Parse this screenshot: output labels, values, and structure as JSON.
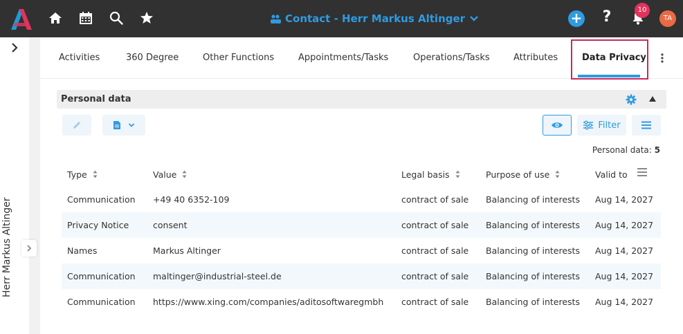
{
  "header": {
    "title": "Contact - Herr Markus Altinger",
    "notification_count": "10",
    "avatar_initials": "TA",
    "help_label": "?",
    "plus_label": "+",
    "accent_color": "#2f9be0",
    "icons": [
      "home-icon",
      "calendar-icon",
      "search-icon",
      "star-icon",
      "contact-icon",
      "chevron-down-icon",
      "plus-icon",
      "help-icon",
      "bell-icon"
    ]
  },
  "sidebar": {
    "record_name": "Herr Markus Altinger"
  },
  "tabs": [
    {
      "label": "Activities"
    },
    {
      "label": "360 Degree"
    },
    {
      "label": "Other Functions"
    },
    {
      "label": "Appointments/Tasks"
    },
    {
      "label": "Operations/Tasks"
    },
    {
      "label": "Attributes"
    },
    {
      "label": "Data Privacy",
      "active": true
    }
  ],
  "panel": {
    "title": "Personal data",
    "filter_label": "Filter",
    "count_label": "Personal data:",
    "count_value": "5"
  },
  "table": {
    "columns": [
      "Type",
      "Value",
      "Legal basis",
      "Purpose of use",
      "Valid to"
    ],
    "rows": [
      [
        "Communication",
        "+49 40 6352-109",
        "contract of sale",
        "Balancing of interests",
        "Aug 14, 2027"
      ],
      [
        "Privacy Notice",
        "consent",
        "contract of sale",
        "Balancing of interests",
        "Aug 14, 2027"
      ],
      [
        "Names",
        "Markus Altinger",
        "contract of sale",
        "Balancing of interests",
        "Aug 14, 2027"
      ],
      [
        "Communication",
        "maltinger@industrial-steel.de",
        "contract of sale",
        "Balancing of interests",
        "Aug 14, 2027"
      ],
      [
        "Communication",
        "https://www.xing.com/companies/aditosoftwaregmbh",
        "contract of sale",
        "Balancing of interests",
        "Aug 14, 2027"
      ]
    ]
  }
}
